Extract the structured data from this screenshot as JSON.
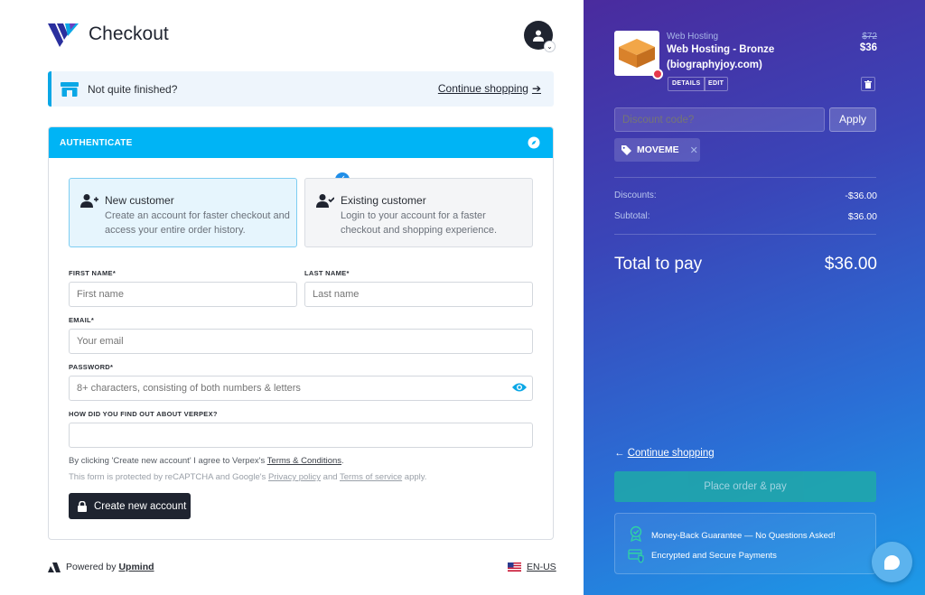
{
  "header": {
    "title": "Checkout"
  },
  "notice": {
    "message": "Not quite finished?",
    "continue_label": "Continue shopping",
    "arrow": "➔"
  },
  "auth": {
    "heading": "AUTHENTICATE",
    "new_customer": {
      "title": "New customer",
      "desc": "Create an account for faster checkout and access your entire order history."
    },
    "existing_customer": {
      "title": "Existing customer",
      "desc": "Login to your account for a faster checkout and shopping experience."
    },
    "fields": {
      "first_name_label": "FIRST NAME*",
      "first_name_placeholder": "First name",
      "last_name_label": "LAST NAME*",
      "last_name_placeholder": "Last name",
      "email_label": "EMAIL*",
      "email_placeholder": "Your email",
      "password_label": "PASSWORD*",
      "password_placeholder": "8+ characters, consisting of both numbers & letters",
      "source_label": "HOW DID YOU FIND OUT ABOUT VERPEX?",
      "source_value": ""
    },
    "terms_prefix": "By clicking 'Create new account' I agree to Verpex's ",
    "terms_link": "Terms & Conditions",
    "terms_suffix": ".",
    "recaptcha_prefix": "This form is protected by reCAPTCHA and Google's ",
    "privacy_link": "Privacy policy",
    "recaptcha_and": " and ",
    "tos_link": "Terms of service",
    "recaptcha_suffix": " apply.",
    "create_button": "Create new account"
  },
  "footer": {
    "powered_by": "Powered by",
    "upmind": "Upmind",
    "language": "EN-US"
  },
  "cart": {
    "item": {
      "category": "Web Hosting",
      "name": "Web Hosting - Bronze",
      "domain": "(biographyjoy.com)",
      "old_price": "$72",
      "price": "$36",
      "details_label": "DETAILS",
      "edit_label": "EDIT"
    },
    "discount_placeholder": "Discount code?",
    "apply_label": "Apply",
    "coupon": "MOVEME",
    "discounts_label": "Discounts:",
    "discounts_value": "-$36.00",
    "subtotal_label": "Subtotal:",
    "subtotal_value": "$36.00",
    "total_label": "Total to pay",
    "total_value": "$36.00",
    "continue_label": "Continue shopping",
    "continue_arrow": "←",
    "place_order": "Place order & pay",
    "guarantee": "Money-Back Guarantee — No Questions Asked!",
    "secure": "Encrypted and Secure Payments"
  },
  "colors": {
    "accent": "#00b4f5",
    "dark": "#1f2430",
    "place_button": "#1fa9a8"
  }
}
